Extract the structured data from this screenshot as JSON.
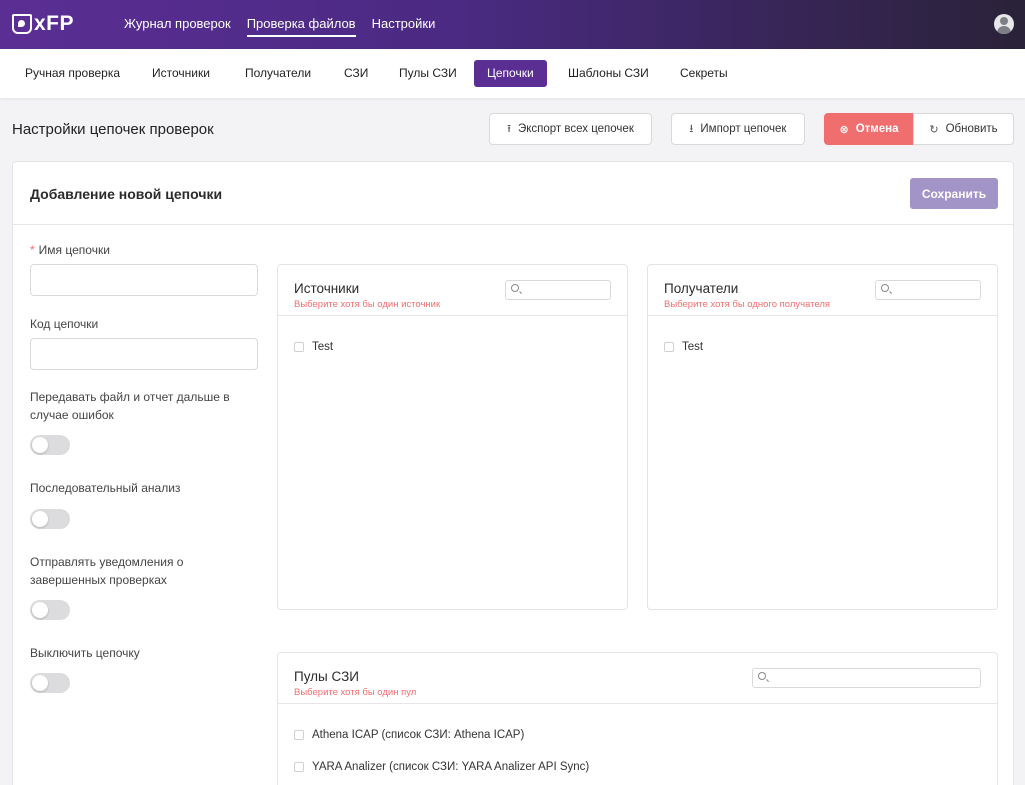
{
  "app": {
    "logo": "xFP"
  },
  "topnav": [
    {
      "label": "Журнал проверок",
      "active": false
    },
    {
      "label": "Проверка файлов",
      "active": true
    },
    {
      "label": "Настройки",
      "active": false
    }
  ],
  "subtabs": [
    {
      "label": "Ручная проверка",
      "active": false
    },
    {
      "label": "Источники",
      "active": false
    },
    {
      "label": "Получатели",
      "active": false
    },
    {
      "label": "СЗИ",
      "active": false
    },
    {
      "label": "Пулы СЗИ",
      "active": false
    },
    {
      "label": "Цепочки",
      "active": true
    },
    {
      "label": "Шаблоны СЗИ",
      "active": false
    },
    {
      "label": "Секреты",
      "active": false
    }
  ],
  "page": {
    "title": "Настройки цепочек проверок",
    "export_label": "Экспорт всех цепочек",
    "import_label": "Импорт цепочек",
    "cancel_label": "Отмена",
    "refresh_label": "Обновить"
  },
  "form": {
    "title": "Добавление новой цепочки",
    "save_label": "Сохранить",
    "required_mark": "*",
    "name_label": "Имя цепочки",
    "name_value": "",
    "code_label": "Код цепочки",
    "code_value": "",
    "toggles": [
      {
        "label_line1": "Передавать файл и отчет дальше в",
        "label_line2": "случае ошибок",
        "on": false
      },
      {
        "label_line1": "Последовательный анализ",
        "label_line2": "",
        "on": false
      },
      {
        "label_line1": "Отправлять уведомления о",
        "label_line2": "завершенных проверках",
        "on": false
      },
      {
        "label_line1": "Выключить цепочку",
        "label_line2": "",
        "on": false
      }
    ]
  },
  "sources": {
    "title": "Источники",
    "hint": "Выберите хотя бы один источник",
    "search_value": "",
    "items": [
      {
        "label": "Test",
        "checked": false
      }
    ]
  },
  "recipients": {
    "title": "Получатели",
    "hint": "Выберите хотя бы одного получателя",
    "search_value": "",
    "items": [
      {
        "label": "Test",
        "checked": false
      }
    ]
  },
  "pools": {
    "title": "Пулы СЗИ",
    "hint": "Выберите хотя бы один пул",
    "search_value": "",
    "items": [
      {
        "label": "Athena ICAP (список СЗИ: Athena ICAP)",
        "checked": false
      },
      {
        "label": "YARA Analizer (список СЗИ: YARA Analizer API Sync)",
        "checked": false
      }
    ]
  },
  "colors": {
    "header_start": "#5b2e94",
    "header_end": "#2a2238",
    "accent": "#5b2e94",
    "danger": "#f06e6e",
    "save_disabled": "#a394c7"
  }
}
